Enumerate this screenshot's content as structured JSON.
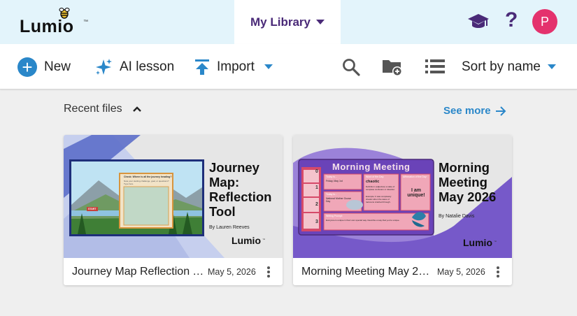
{
  "app": {
    "logo_text": "Lumio",
    "logo_tm": "™"
  },
  "header": {
    "library_tab_label": "My Library",
    "avatar_initial": "P",
    "help_glyph": "?"
  },
  "toolbar": {
    "new_label": "New",
    "ai_lesson_label": "AI lesson",
    "import_label": "Import",
    "sort_label": "Sort by name"
  },
  "recent": {
    "heading": "Recent files",
    "see_more": "See more",
    "files": [
      {
        "name": "Journey Map Reflection Tool",
        "date": "May 5, 2026",
        "thumb_title": "Journey Map: Reflection Tool",
        "thumb_author": "By Lauren Reeves",
        "thumb_brand": "Lumio",
        "thumb_brand_tm": "™",
        "slide_prompt": "Check: Where is all the journey heading?",
        "slide_subprompt": "Note your starting challenge, goal, or questions? Type here.",
        "slide_tag": "START"
      },
      {
        "name": "Morning Meeting May 2026",
        "date": "May 5, 2026",
        "thumb_title": "Morning Meeting May 2026",
        "thumb_author": "By Natalie Davis",
        "thumb_brand": "Lumio",
        "thumb_brand_tm": "™",
        "slide_heading": "Morning Meeting",
        "slide_ladder": [
          "0",
          "1",
          "2",
          "3"
        ],
        "slide_today": "Today is...",
        "slide_today_value": "Friday, May 1st",
        "slide_word_label": "Word of the Day:",
        "slide_word": "chaotic",
        "slide_definition": "Definition: (adjective) a state of complete confusion or disorder.",
        "slide_example": "Example: It was completely chaotic when the wave of raccoons crashed through.",
        "slide_affirm_label": "Affirmation of the Day:",
        "slide_affirm": "I am unique!",
        "slide_today_in": "Today is...",
        "slide_national": "National Mother Goose Day",
        "slide_writing_label": "Writing Prompt:",
        "slide_writing": "Everyone is unique in their own special way. Describe a way that you're unique."
      }
    ]
  },
  "colors": {
    "accent": "#2a87c9",
    "brand_purple": "#4a2a78",
    "avatar": "#e4326d",
    "topbar": "#e3f4fb"
  }
}
